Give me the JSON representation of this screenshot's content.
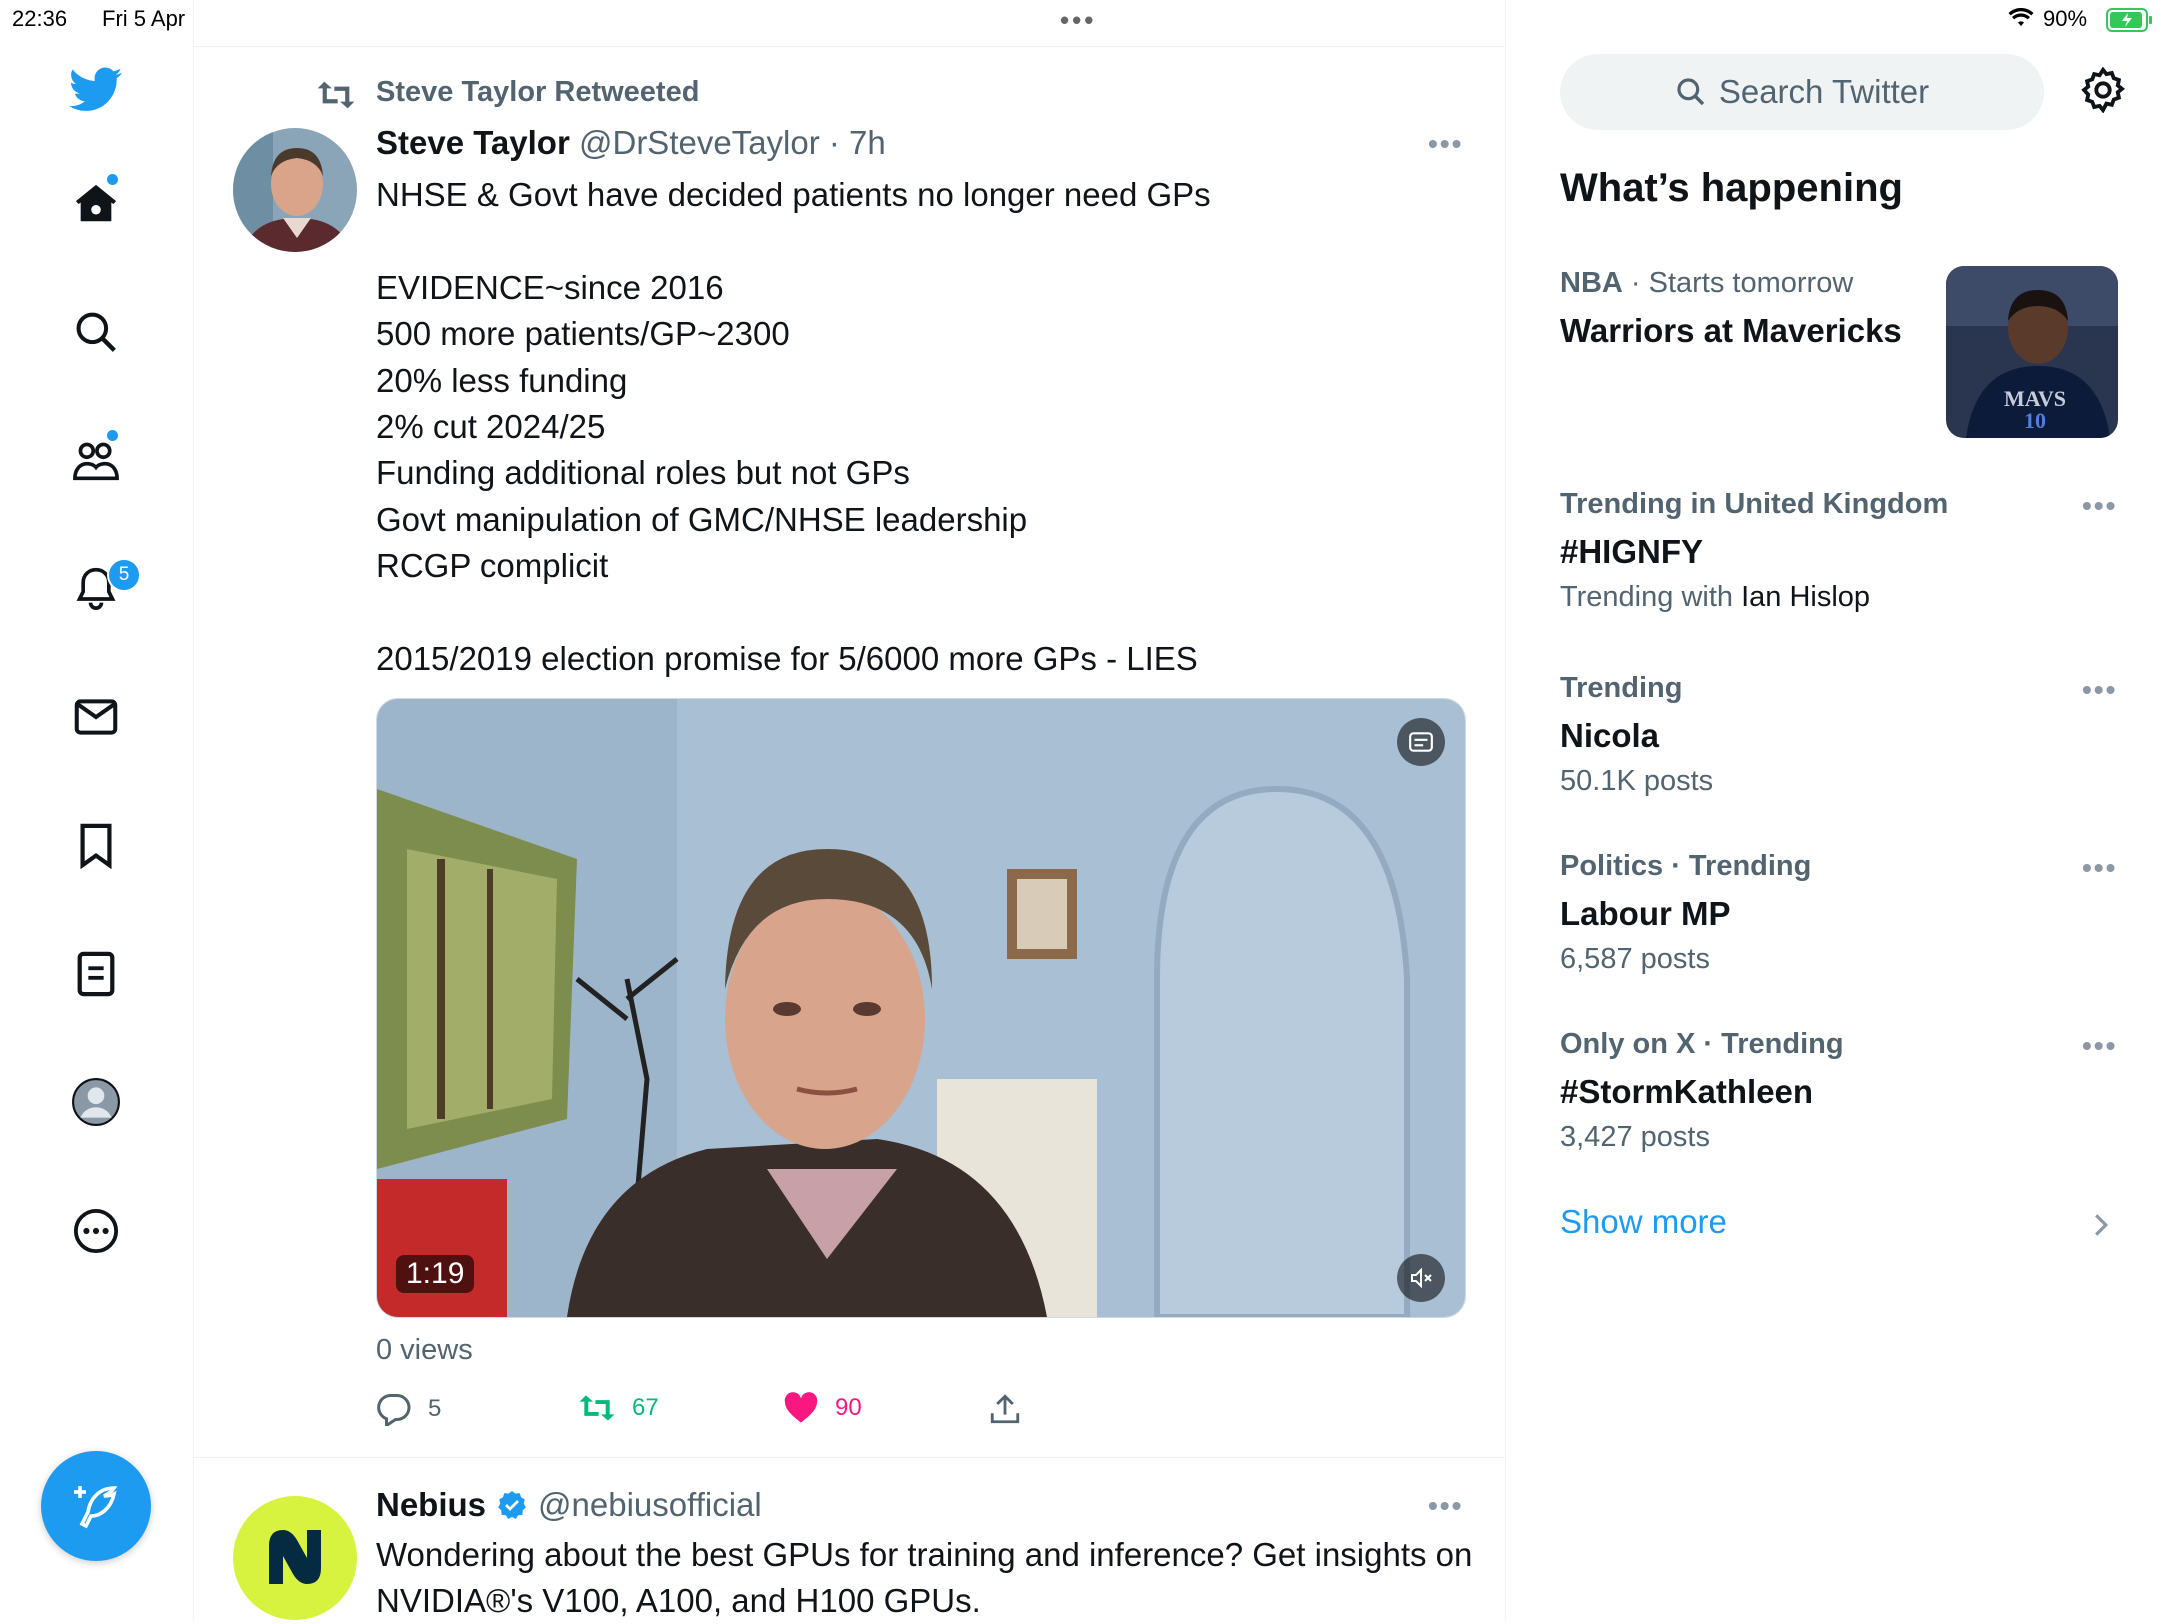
{
  "status_bar": {
    "time": "22:36",
    "date": "Fri 5 Apr",
    "battery": "90%"
  },
  "nav": {
    "notification_count": "5"
  },
  "tweet": {
    "retweet_label": "Steve Taylor Retweeted",
    "name": "Steve Taylor",
    "handle": "@DrSteveTaylor",
    "time": "· 7h",
    "text": "NHSE & Govt have decided patients no longer need GPs\n\nEVIDENCE~since 2016\n500 more patients/GP~2300\n20% less funding\n2% cut 2024/25\nFunding additional roles but not GPs\nGovt manipulation of GMC/NHSE leadership\nRCGP complicit\n\n2015/2019 election promise for 5/6000 more GPs - LIES",
    "video_duration": "1:19",
    "views": "0 views",
    "replies": "5",
    "retweets": "67",
    "likes": "90"
  },
  "next_tweet": {
    "name": "Nebius",
    "handle": "@nebiusofficial",
    "text": "Wondering about the best GPUs for training and inference? Get insights on NVIDIA®'s V100, A100, and H100 GPUs."
  },
  "sidebar": {
    "search_placeholder": "Search Twitter",
    "title": "What’s happening",
    "trends": [
      {
        "meta_bold": "NBA",
        "meta": " · Starts tomorrow",
        "name": "Warriors at Mavericks",
        "sub": ""
      },
      {
        "meta_bold": "Trending in United Kingdom",
        "meta": "",
        "name": "#HIGNFY",
        "sub": "Trending with ",
        "sub_strong": "Ian Hislop"
      },
      {
        "meta_bold": "Trending",
        "meta": "",
        "name": "Nicola",
        "sub": "50.1K posts"
      },
      {
        "meta_bold": "Politics · Trending",
        "meta": "",
        "name": "Labour MP",
        "sub": "6,587 posts"
      },
      {
        "meta_bold": "Only on X · Trending",
        "meta": "",
        "name": "#StormKathleen",
        "sub": "3,427 posts"
      }
    ],
    "show_more": "Show more"
  },
  "colors": {
    "accent": "#1d9bf0",
    "like": "#f91880",
    "retweet": "#00ba7c"
  }
}
